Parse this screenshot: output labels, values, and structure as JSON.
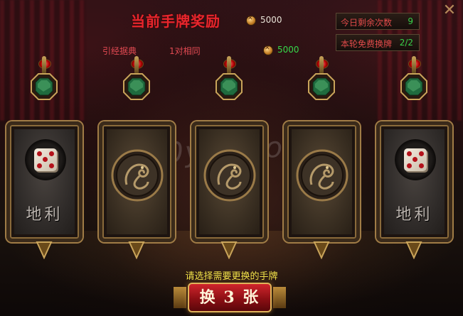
{
  "title": "当前手牌奖励",
  "reward": {
    "icon": "coin-icon",
    "amount": "5000"
  },
  "combo": {
    "card_name": "引经据典",
    "match_text": "1对相同",
    "icon": "coin-icon",
    "amount": "5000"
  },
  "status": {
    "daily_remaining_label": "今日剩余次数",
    "daily_remaining_value": "9",
    "free_swap_label": "本轮免费换牌",
    "free_swap_value": "2/2"
  },
  "close_label": "✕",
  "cards": [
    {
      "state": "face-up",
      "label": "地利",
      "icon": "dice-icon"
    },
    {
      "state": "face-down",
      "icon": "dragon-icon"
    },
    {
      "state": "face-down",
      "icon": "dragon-icon"
    },
    {
      "state": "face-down",
      "icon": "dragon-icon"
    },
    {
      "state": "face-up",
      "label": "地利",
      "icon": "dice-icon"
    }
  ],
  "hint": "请选择需要更换的手牌",
  "swap_button": "换 3 张",
  "watermark": "8090yxs.com",
  "colors": {
    "title_red": "#e8262d",
    "value_green": "#38d14a",
    "hint_yellow": "#f2e24a",
    "button_red": "#b5161d"
  }
}
